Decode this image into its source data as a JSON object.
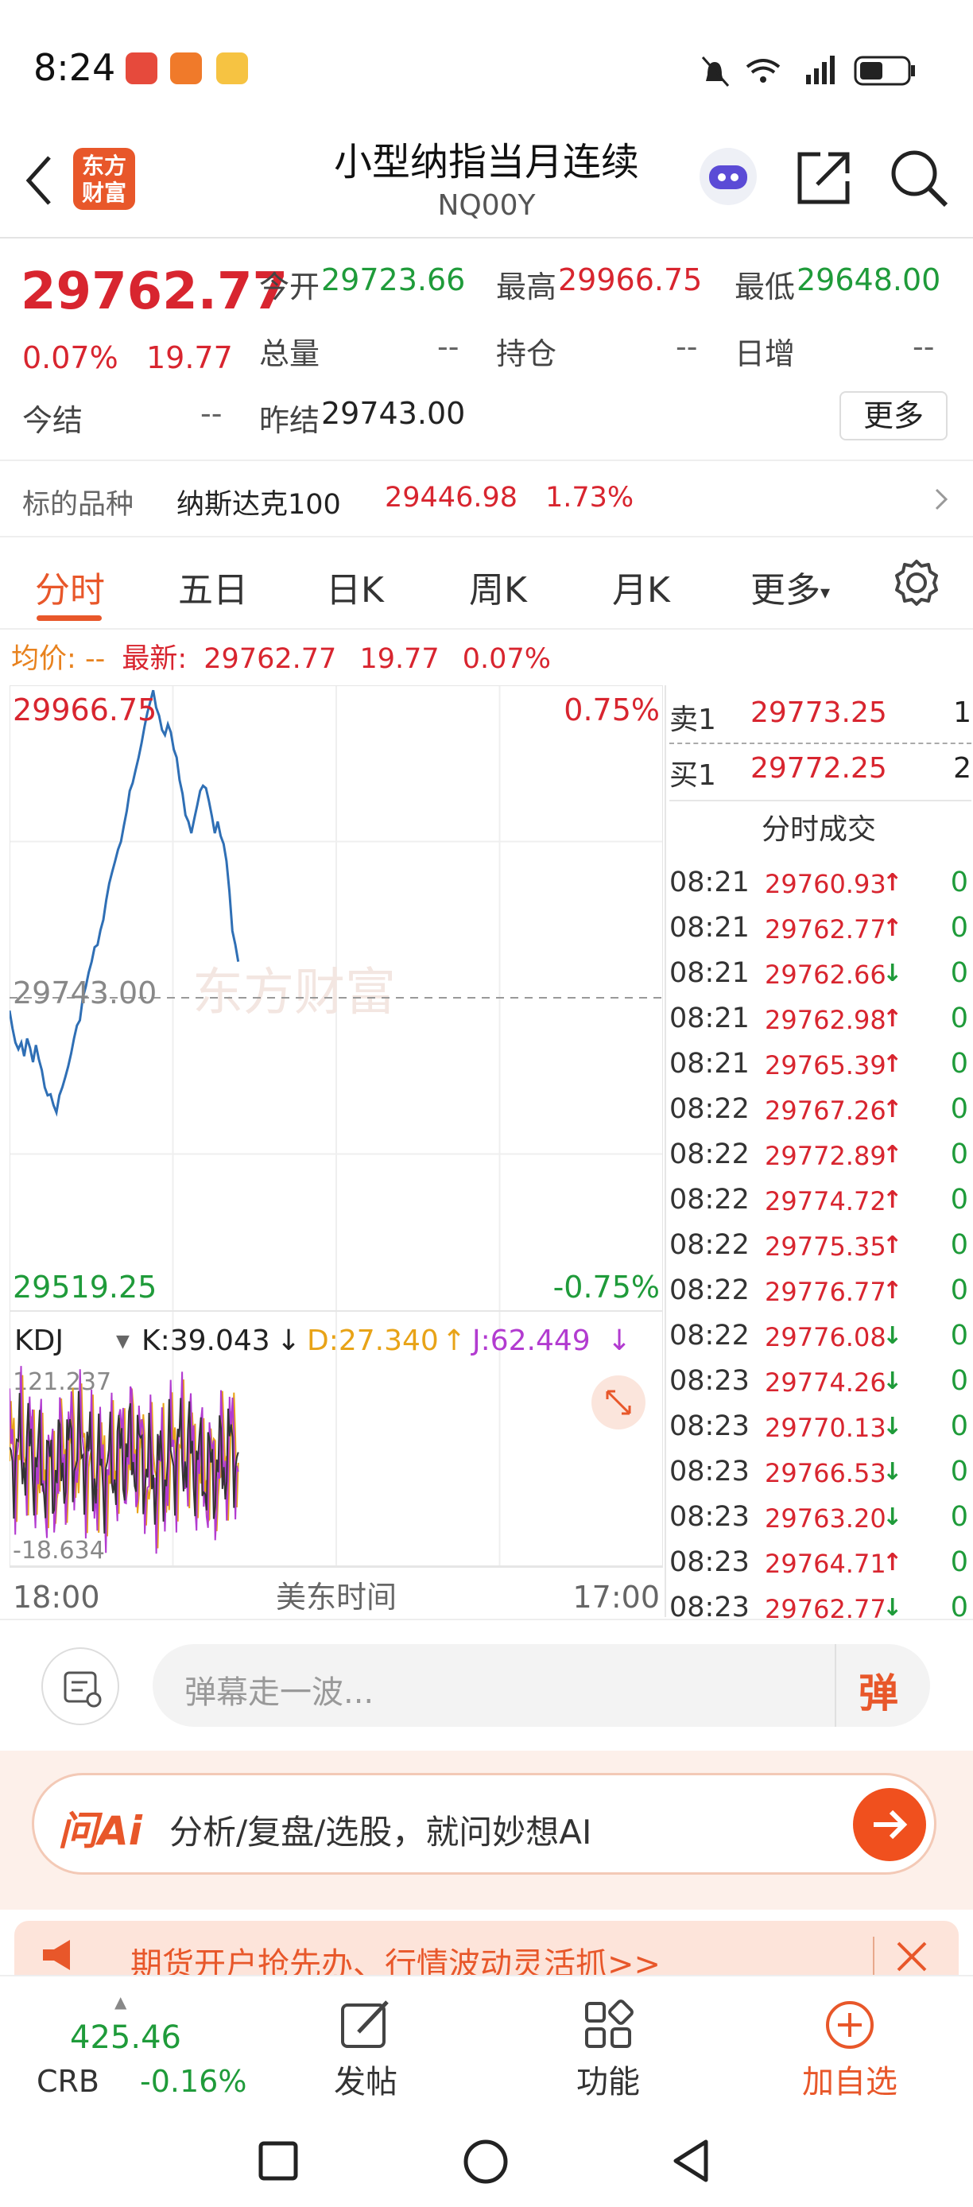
{
  "status_bar": {
    "time": "8:24"
  },
  "header": {
    "back_icon": "chevron-left-icon",
    "logo_text_1": "东方",
    "logo_text_2": "财富",
    "title": "小型纳指当月连续",
    "code": "NQ00Y"
  },
  "quote": {
    "price": "29762.77",
    "change_pct": "0.07%",
    "change_val": "19.77",
    "open_label": "今开",
    "open": "29723.66",
    "high_label": "最高",
    "high": "29966.75",
    "low_label": "最低",
    "low": "29648.00",
    "volume_label": "总量",
    "volume": "--",
    "position_label": "持仓",
    "position": "--",
    "daily_inc_label": "日增",
    "daily_inc": "--",
    "settle_label": "今结",
    "settle": "--",
    "prev_settle_label": "昨结",
    "prev_settle": "29743.00",
    "more_label": "更多"
  },
  "underlying": {
    "label": "标的品种",
    "name": "纳斯达克100",
    "value": "29446.98",
    "pct": "1.73%"
  },
  "tabs": [
    {
      "label": "分时"
    },
    {
      "label": "五日"
    },
    {
      "label": "日K"
    },
    {
      "label": "周K"
    },
    {
      "label": "月K"
    },
    {
      "label": "更多"
    }
  ],
  "info_line": {
    "avg_label": "均价:",
    "avg_value": "--",
    "latest_label": "最新:",
    "latest_value": "29762.77",
    "change": "19.77",
    "pct": "0.07%"
  },
  "chart_data": {
    "type": "line",
    "y_top_label": "29966.75",
    "y_mid_label": "29743.00",
    "y_bottom_label": "29519.25",
    "pct_top_label": "0.75%",
    "pct_bottom_label": "-0.75%",
    "watermark": "东方财富",
    "ylim": [
      29519.25,
      29966.75
    ],
    "prev_settle": 29743.0,
    "x_left_label": "18:00",
    "x_mid_label": "美东时间",
    "x_right_label": "17:00",
    "price_series": [
      29735,
      29720,
      29712,
      29705,
      29712,
      29700,
      29715,
      29706,
      29698,
      29708,
      29700,
      29690,
      29680,
      29672,
      29675,
      29665,
      29662,
      29672,
      29680,
      29685,
      29695,
      29702,
      29715,
      29722,
      29728,
      29742,
      29752,
      29760,
      29770,
      29778,
      29782,
      29790,
      29800,
      29812,
      29826,
      29832,
      29842,
      29848,
      29856,
      29865,
      29878,
      29890,
      29898,
      29905,
      29916,
      29924,
      29938,
      29946,
      29956,
      29962,
      29952,
      29944,
      29936,
      29930,
      29940,
      29932,
      29922,
      29914,
      29900,
      29888,
      29875,
      29868,
      29862,
      29870,
      29882,
      29890,
      29896,
      29892,
      29885,
      29872,
      29862,
      29868,
      29860,
      29852,
      29842,
      29818,
      29792,
      29780,
      29770
    ],
    "kdj": {
      "label": "KDJ",
      "k_text": "K:39.043",
      "d_text": "D:27.340",
      "j_text": "J:62.449",
      "top_label": "121.237",
      "bottom_label": "-18.634",
      "k": 39.043,
      "d": 27.34,
      "j": 62.449
    }
  },
  "order_book": {
    "sell_label": "卖1",
    "sell_price": "29773.25",
    "sell_qty": "1",
    "buy_label": "买1",
    "buy_price": "29772.25",
    "buy_qty": "2",
    "trades_title": "分时成交",
    "trades": [
      {
        "time": "08:21",
        "price": "29760.93",
        "dir": "up",
        "qty": "0"
      },
      {
        "time": "08:21",
        "price": "29762.77",
        "dir": "up",
        "qty": "0"
      },
      {
        "time": "08:21",
        "price": "29762.66",
        "dir": "down",
        "qty": "0"
      },
      {
        "time": "08:21",
        "price": "29762.98",
        "dir": "up",
        "qty": "0"
      },
      {
        "time": "08:21",
        "price": "29765.39",
        "dir": "up",
        "qty": "0"
      },
      {
        "time": "08:22",
        "price": "29767.26",
        "dir": "up",
        "qty": "0"
      },
      {
        "time": "08:22",
        "price": "29772.89",
        "dir": "up",
        "qty": "0"
      },
      {
        "time": "08:22",
        "price": "29774.72",
        "dir": "up",
        "qty": "0"
      },
      {
        "time": "08:22",
        "price": "29775.35",
        "dir": "up",
        "qty": "0"
      },
      {
        "time": "08:22",
        "price": "29776.77",
        "dir": "up",
        "qty": "0"
      },
      {
        "time": "08:22",
        "price": "29776.08",
        "dir": "down",
        "qty": "0"
      },
      {
        "time": "08:23",
        "price": "29774.26",
        "dir": "down",
        "qty": "0"
      },
      {
        "time": "08:23",
        "price": "29770.13",
        "dir": "down",
        "qty": "0"
      },
      {
        "time": "08:23",
        "price": "29766.53",
        "dir": "down",
        "qty": "0"
      },
      {
        "time": "08:23",
        "price": "29763.20",
        "dir": "down",
        "qty": "0"
      },
      {
        "time": "08:23",
        "price": "29764.71",
        "dir": "up",
        "qty": "0"
      },
      {
        "time": "08:23",
        "price": "29762.77",
        "dir": "down",
        "qty": "0"
      }
    ]
  },
  "danmu": {
    "placeholder": "弹幕走一波...",
    "danmu_btn": "弹"
  },
  "ai_bar": {
    "brand": "问Ai",
    "text": "分析/复盘/选股，就问妙想AI"
  },
  "notice": {
    "text": "期货开户抢先办、行情波动灵活抓>>"
  },
  "bottom_nav": {
    "index_value": "425.46",
    "index_name": "CRB",
    "index_pct": "-0.16%",
    "post_label": "发帖",
    "func_label": "功能",
    "add_label": "加自选"
  },
  "colors": {
    "up": "#d8252f",
    "down": "#1f9b3a",
    "accent": "#e8572a",
    "line": "#2f6fb5"
  }
}
